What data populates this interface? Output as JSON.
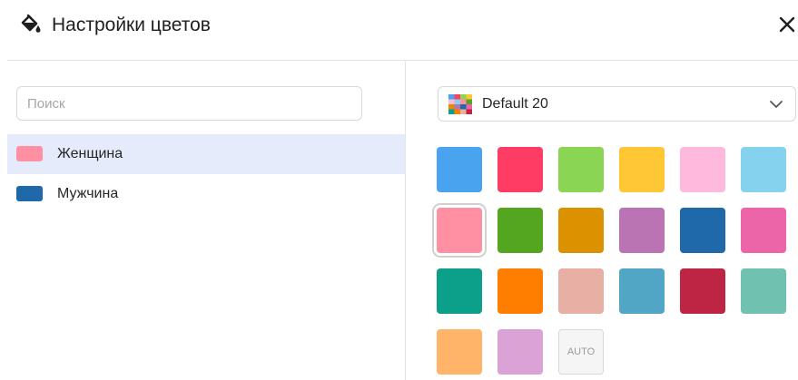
{
  "dialog": {
    "title": "Настройки цветов",
    "title_icon": "paint-bucket-icon",
    "close_icon": "close-icon"
  },
  "search": {
    "placeholder": "Поиск",
    "value": ""
  },
  "items": [
    {
      "label": "Женщина",
      "color": "#ff8fa3",
      "selected": true
    },
    {
      "label": "Мужчина",
      "color": "#1f68a9",
      "selected": false
    }
  ],
  "palette": {
    "selected_label": "Default 20",
    "icon": "palette-mosaic-icon",
    "chevron_icon": "chevron-down-icon"
  },
  "swatches": [
    "#4aa3ef",
    "#ff3d64",
    "#8ad554",
    "#ffc636",
    "#ffb9dd",
    "#84d2ed",
    "#ff8fa3",
    "#54a520",
    "#db9100",
    "#ba74b3",
    "#1f68a9",
    "#ed65a9",
    "#0ca08b",
    "#ff7e00",
    "#e8b0a4",
    "#52a6c5",
    "#be2443",
    "#70c1b0",
    "#ffb46a",
    "#dba3d5"
  ],
  "selected_swatch": "#ff8fa3",
  "auto_label": "AUTO"
}
